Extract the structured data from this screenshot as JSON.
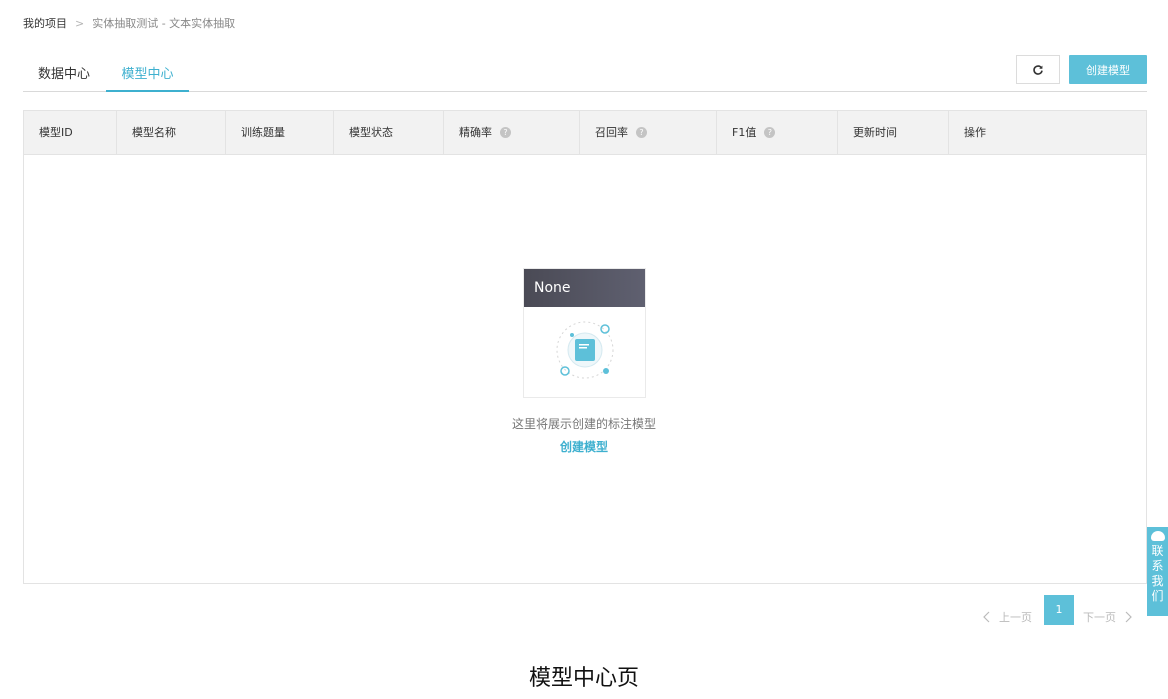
{
  "breadcrumb": {
    "root": "我的项目",
    "separator": ">",
    "current": "实体抽取测试 - 文本实体抽取"
  },
  "tabs": [
    {
      "label": "数据中心"
    },
    {
      "label": "模型中心"
    }
  ],
  "toolbar": {
    "refresh_icon": "refresh-icon",
    "create_label": "创建模型"
  },
  "table": {
    "columns": [
      "模型ID",
      "模型名称",
      "训练题量",
      "模型状态",
      "精确率",
      "召回率",
      "F1值",
      "更新时间",
      "操作"
    ],
    "help_icon": "?"
  },
  "empty": {
    "image_title": "None",
    "message": "这里将展示创建的标注模型",
    "link": "创建模型"
  },
  "pagination": {
    "prev": "上一页",
    "current": "1",
    "next": "下一页"
  },
  "contact": {
    "l1": "联",
    "l2": "系",
    "l3": "我",
    "l4": "们"
  },
  "caption": "模型中心页",
  "colors": {
    "accent": "#5dc0d9",
    "tab_active": "#3eb0cf",
    "header_bg": "#f2f2f2"
  }
}
